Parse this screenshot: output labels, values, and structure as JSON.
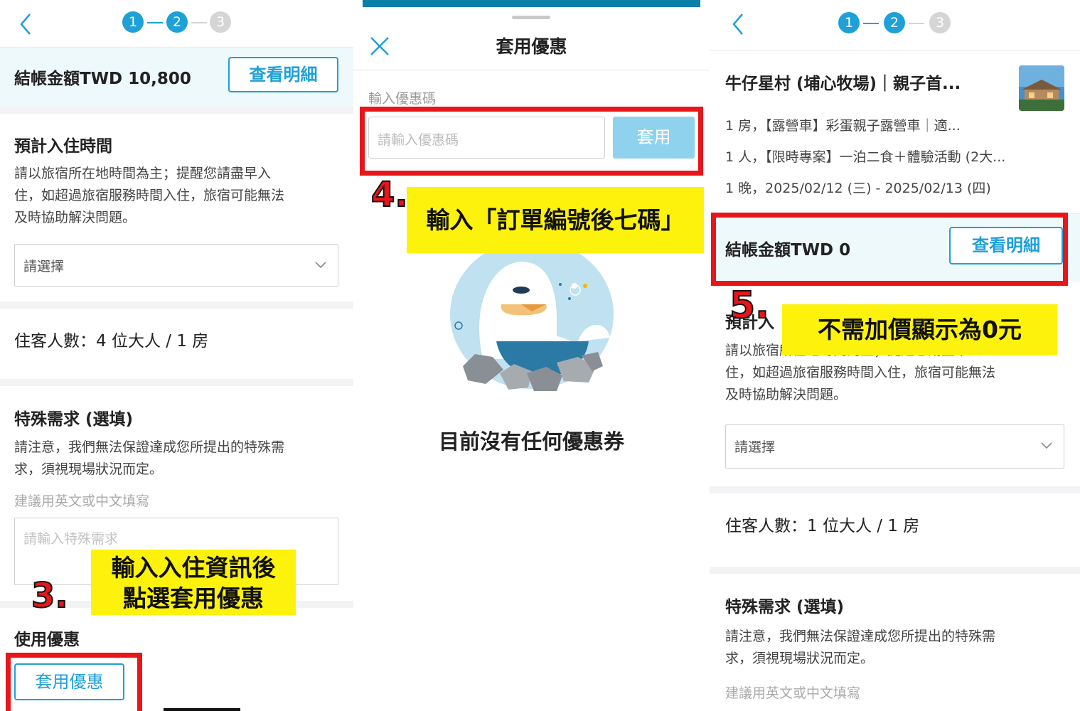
{
  "colors": {
    "accent": "#1ea0d9",
    "highlight_red": "#e8151b",
    "note_yellow": "#fcf20c"
  },
  "panel1": {
    "steps": [
      "1",
      "2",
      "3"
    ],
    "amount_label": "結帳金額TWD 10,800",
    "view_details": "查看明細",
    "checkin": {
      "title": "預計入住時間",
      "desc": [
        "請以旅宿所在地時間為主；提醒您請盡早入",
        "住，如超過旅宿服務時間入住，旅宿可能無法",
        "及時協助解決問題。"
      ],
      "select_placeholder": "請選擇"
    },
    "guests": "住客人數：4 位大人 / 1 房",
    "special": {
      "title": "特殊需求 (選填)",
      "desc": [
        "請注意，我們無法保證達成您所提出的特殊需",
        "求，須視現場狀況而定。"
      ],
      "hint": "建議用英文或中文填寫",
      "placeholder": "請輸入特殊需求"
    },
    "coupon_title": "使用優惠",
    "apply_coupon": "套用優惠",
    "annotation_num": "3.",
    "annotation_lines": [
      "輸入入住資訊後",
      "點選套用優惠"
    ]
  },
  "panel2": {
    "title": "套用優惠",
    "label": "輸入優惠碼",
    "placeholder": "請輸入優惠碼",
    "apply": "套用",
    "empty": "目前沒有任何優惠券",
    "annotation_num": "4.",
    "annotation_text": "輸入「訂單編號後七碼」"
  },
  "panel3": {
    "steps": [
      "1",
      "2",
      "3"
    ],
    "hotel_name": "牛仔星村 (埔心牧場)｜親子首...",
    "lines": [
      "1 房，【露營車】彩蛋親子露營車｜適...",
      "1 人，【限時專案】一泊二食＋體驗活動 (2大...",
      "1 晚，2025/02/12 (三) - 2025/02/13 (四)"
    ],
    "amount_label": "結帳金額TWD 0",
    "view_details": "查看明細",
    "checkin_title_partial": "預計入",
    "desc_line1_partial": "請以旅宿所在地時間為主；提醒您請盡早入",
    "desc": [
      "住，如超過旅宿服務時間入住，旅宿可能無法",
      "及時協助解決問題。"
    ],
    "select_placeholder": "請選擇",
    "guests": "住客人數：1 位大人 / 1 房",
    "special": {
      "title": "特殊需求 (選填)",
      "desc": [
        "請注意，我們無法保證達成您所提出的特殊需",
        "求，須視現場狀況而定。"
      ],
      "hint": "建議用英文或中文填寫"
    },
    "annotation_num": "5.",
    "annotation_text": "不需加價顯示為0元"
  },
  "icons": [
    "back-arrow-icon",
    "chevron-down-icon",
    "close-icon",
    "empty-coupon-illustration",
    "hotel-thumbnail"
  ]
}
